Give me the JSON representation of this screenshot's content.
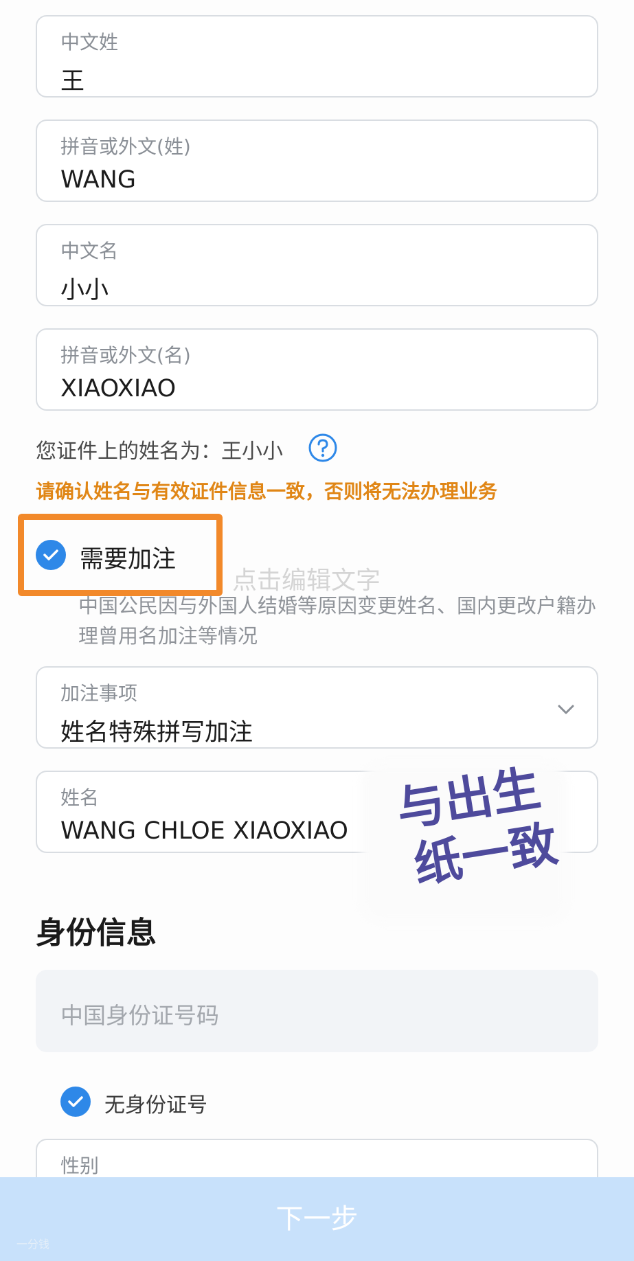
{
  "fields": [
    {
      "label": "中文姓",
      "value": "王"
    },
    {
      "label": "拼音或外文(姓)",
      "value": "WANG"
    },
    {
      "label": "中文名",
      "value": "小小"
    },
    {
      "label": "拼音或外文(名)",
      "value": "XIAOXIAO"
    }
  ],
  "name_hint": "您证件上的姓名为：王小小",
  "warning": "请确认姓名与有效证件信息一致，否则将无法办理业务",
  "need_annotation": {
    "label": "需要加注",
    "checked": true,
    "description": "中国公民因与外国人结婚等原因变更姓名、国内更改户籍办理曾用名加注等情况"
  },
  "ghost_text": "点击编辑文字",
  "annotation_item": {
    "label": "加注事项",
    "value": "姓名特殊拼写加注"
  },
  "annotation_name": {
    "label": "姓名",
    "value": "WANG CHLOE XIAOXIAO"
  },
  "handwritten_note": {
    "line1": "与出生",
    "line2": "纸一致"
  },
  "identity_section": {
    "title": "身份信息",
    "id_placeholder": "中国身份证号码",
    "no_id_label": "无身份证号",
    "no_id_checked": true,
    "gender_label": "性别"
  },
  "next_button": "下一步",
  "watermark": "一分钱",
  "colors": {
    "accent": "#2e88e8",
    "warning": "#e08616",
    "highlight": "#f2892a",
    "button_bg": "#c8e1fb",
    "annotation_ink": "#4e4a9c"
  }
}
